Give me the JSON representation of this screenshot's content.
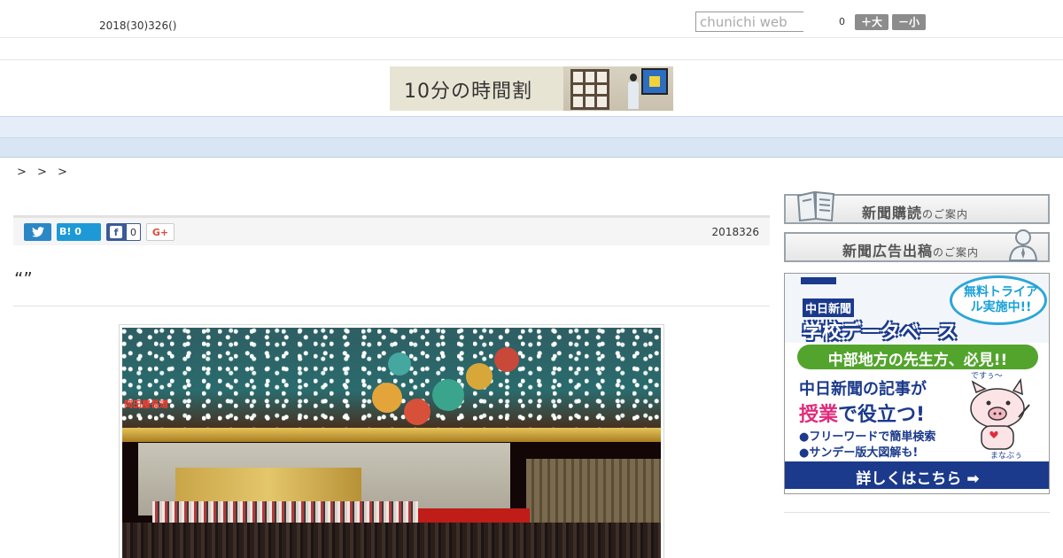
{
  "header": {
    "date": "2018(30)326()",
    "search_placeholder": "chunichi web",
    "font_size_value": "0",
    "font_larger_label": "＋大",
    "font_smaller_label": "－小"
  },
  "banner": {
    "text": "10分の時間割"
  },
  "nav": {
    "items": [
      "",
      "",
      "",
      "",
      "",
      "",
      "",
      "",
      ""
    ]
  },
  "breadcrumb": "> > >",
  "share": {
    "hatena_label": "B!",
    "hatena_count": "0",
    "facebook_count": "0",
    "gplus_label": "G+"
  },
  "article": {
    "date": "2018326",
    "headline": "“”",
    "photo_sign": "岡田屋長道"
  },
  "sidebar": {
    "subscribe": {
      "label": "新聞購読",
      "suffix": "のご案内"
    },
    "advertise": {
      "label": "新聞広告出稿",
      "suffix": "のご案内"
    },
    "ad": {
      "brand1": "中日新聞",
      "brand2": "学校データベース",
      "bubble": "無料トライアル実施中!!",
      "green": "中部地方の先生方、必見!!",
      "line1": "中日新聞の記事が",
      "line2_highlight": "授業",
      "line2_rest": "で役立つ!",
      "bullet1": "●フリーワードで簡単検索",
      "bullet2": "●サンデー版大図解も!",
      "pig_tag": "ですぅ〜",
      "pig_name": "まなぶぅ",
      "footer": "詳しくはこちら ➡"
    }
  },
  "colors": {
    "nav_bg": "#e5eef8",
    "twitter": "#2b87c6",
    "hatena": "#1d9ad6",
    "facebook": "#3a5a98",
    "ad_navy": "#1b3a8c",
    "ad_green": "#53a42d"
  }
}
